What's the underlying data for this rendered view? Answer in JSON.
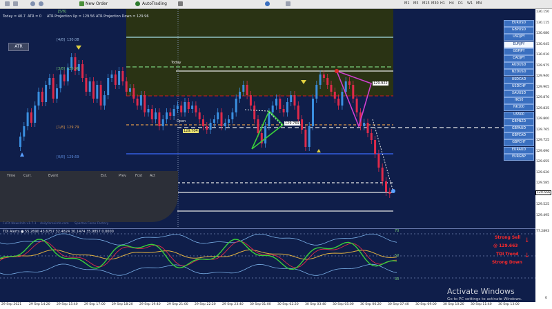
{
  "toolbar": {
    "new_order": "New Order",
    "auto_trading": "AutoTrading",
    "timeframes": [
      "M1",
      "M5",
      "M15",
      "M30",
      "H1",
      "H4",
      "D1",
      "W1",
      "MN"
    ]
  },
  "info_line": {
    "today": "Today = 40.7",
    "atr": "ATR = 0",
    "atr_up": "ATR Projection Up = 129.56",
    "atr_down": "ATR Projection Down = 129.96"
  },
  "atr_button": "ATR",
  "today_label": "Today",
  "open_label": "Open",
  "levels": {
    "l58": "[5/8]",
    "l48": "[4/8]",
    "l48_price": "130.08",
    "l38": "[3/8]",
    "l38_price": "129.96",
    "l18": "[1/8]",
    "l18_price": "129.79",
    "l08": "[0/8]",
    "l08_price": "129.69"
  },
  "price_tags": {
    "a": "129.704",
    "b": "129.769",
    "c": "129.922",
    "current": "129.556"
  },
  "pairs": [
    "EURUSD",
    "GBPUSD",
    "USDJPY",
    "EURJPY",
    "GBPJPY",
    "CADJPY",
    "AUDUSD",
    "NZDUSD",
    "USDCAD",
    "USDCHF",
    "XAUUSD",
    "HK50",
    "NK100",
    "US500",
    "GBPNZD",
    "GBPAUD",
    "GBPCAD",
    "GBPCHF",
    "EURAUD",
    "EURGBP"
  ],
  "selected_pair": "EURJPY",
  "news_headers": [
    "Time",
    "Curr.",
    "Event",
    "Est.",
    "Prev",
    "Fcst",
    "Act"
  ],
  "footer": {
    "left": "FxFX NewsInfo v1.7.1",
    "mid": "dailyforexinfo.com",
    "right": "Spartan Forex Factory"
  },
  "price_axis": [
    "130.150",
    "130.115",
    "130.080",
    "130.045",
    "130.010",
    "129.975",
    "129.940",
    "129.905",
    "129.870",
    "129.835",
    "129.800",
    "129.765",
    "129.725",
    "129.690",
    "129.655",
    "129.620",
    "129.585",
    "129.550",
    "129.525",
    "129.495"
  ],
  "tdi": {
    "header": "TDI Alerts ● 55.2690 43.6757 32.4824 30.1474 35.9857 0.0000",
    "level_70": "70",
    "level_50": "50",
    "level_30": "30",
    "signal1_line1": "Strong Sell",
    "signal1_line2": "@ 129.663",
    "signal2_line1": "TDI Trend",
    "signal2_line2": "Strong Down",
    "axis_top": "77.2893",
    "axis_bottom": "0"
  },
  "time_axis": [
    "29 Sep 2021",
    "29 Sep 14:20",
    "29 Sep 15:40",
    "29 Sep 17:00",
    "29 Sep 18:20",
    "29 Sep 19:40",
    "29 Sep 21:00",
    "29 Sep 22:20",
    "29 Sep 23:40",
    "30 Sep 01:00",
    "30 Sep 02:20",
    "30 Sep 03:40",
    "30 Sep 05:00",
    "30 Sep 06:20",
    "30 Sep 07:40",
    "30 Sep 09:00",
    "30 Sep 10:20",
    "30 Sep 11:40",
    "30 Sep 13:00"
  ],
  "watermark": {
    "title": "Activate Windows",
    "subtitle": "Go to PC settings to activate Windows."
  }
}
